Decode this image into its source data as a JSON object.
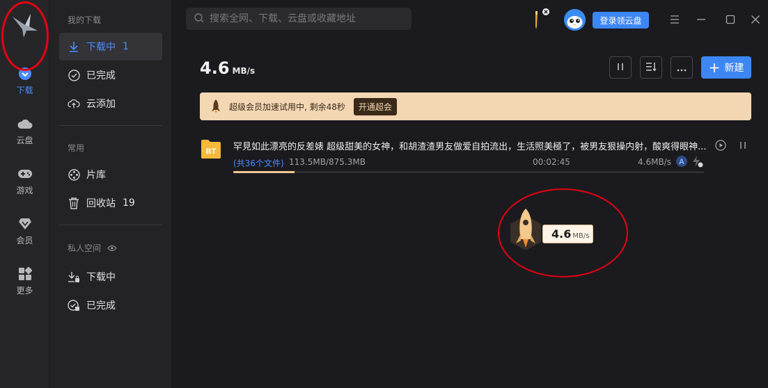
{
  "rail": {
    "items": [
      {
        "label": "下载",
        "icon": "download-circle-icon",
        "active": true
      },
      {
        "label": "云盘",
        "icon": "cloud-icon"
      },
      {
        "label": "游戏",
        "icon": "gamepad-icon"
      },
      {
        "label": "会员",
        "icon": "diamond-icon"
      },
      {
        "label": "更多",
        "icon": "grid-icon"
      }
    ]
  },
  "nav": {
    "section_my": "我的下载",
    "downloading": {
      "label": "下载中",
      "count": "1"
    },
    "completed": {
      "label": "已完成"
    },
    "cloud_add": {
      "label": "云添加"
    },
    "section_common": "常用",
    "library": {
      "label": "片库"
    },
    "recycle": {
      "label": "回收站",
      "count": "19"
    },
    "section_private": "私人空间",
    "private_downloading": {
      "label": "下载中"
    },
    "private_completed": {
      "label": "已完成"
    }
  },
  "header": {
    "search_placeholder": "搜索全网、下载、云盘或收藏地址",
    "login_label": "登录领云盘"
  },
  "main": {
    "speed_value": "4.6",
    "speed_unit": "MB/s",
    "new_label": "新建"
  },
  "banner": {
    "text": "超级会员加速试用中, 剩余48秒",
    "button": "开通超会"
  },
  "task": {
    "badge": "BT",
    "title": "罕見如此漂亮的反差婊 超级甜美的女神，和胡渣渣男友做爱自拍流出，生活照美極了，被男友狠操内射，酸爽得眼神...",
    "files": "(共36个文件)",
    "size": "113.5MB/875.3MB",
    "time": "00:02:45",
    "speed": "4.6MB/s",
    "progress": 0.13
  },
  "float_widget": {
    "speed_value": "4.6",
    "speed_unit": "MB/s"
  },
  "colors": {
    "accent": "#3d87f5",
    "banner_bg": "#f3d7b3",
    "annotation": "#e60012"
  }
}
